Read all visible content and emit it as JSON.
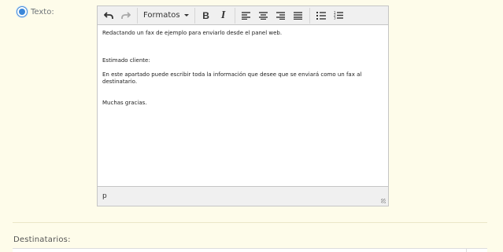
{
  "radio": {
    "label": "Texto:",
    "checked": true
  },
  "toolbar": {
    "undo_icon": "undo-icon",
    "redo_icon": "redo-icon",
    "formats_label": "Formatos",
    "bold_label": "B",
    "italic_label": "I",
    "align_icons": [
      "align-left-icon",
      "align-center-icon",
      "align-right-icon",
      "align-justify-icon"
    ],
    "list_icons": [
      "bullet-list-icon",
      "numbered-list-icon"
    ]
  },
  "content": {
    "paragraphs": [
      "Redactando un fax de ejemplo para enviarlo desde el panel web.",
      "",
      "Estimado cliente:",
      "En este apartado puede escribir toda la información que desee que se enviará como un fax al destinatario.",
      "",
      "Muchas gracias."
    ]
  },
  "statusbar": {
    "path": "p"
  },
  "section": {
    "title": "Destinatarios:"
  },
  "colors": {
    "background": "#fefcea",
    "accent": "#3a86d8"
  }
}
